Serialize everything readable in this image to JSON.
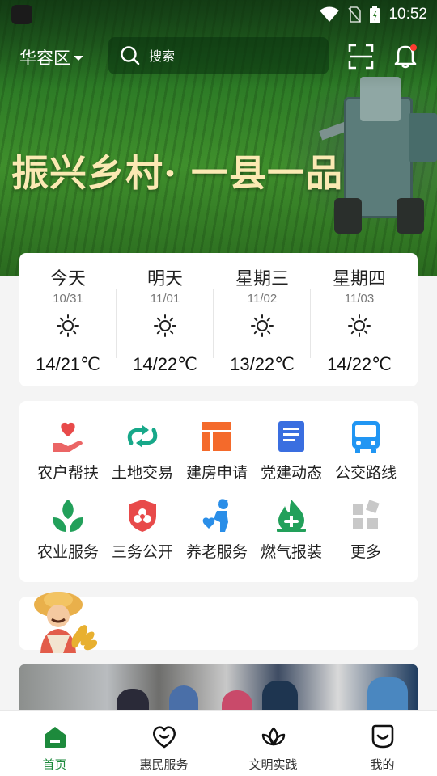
{
  "status_bar": {
    "time": "10:52"
  },
  "header": {
    "district": "华容区",
    "search_placeholder": "搜索"
  },
  "banner": {
    "title": "振兴乡村· 一县一品"
  },
  "weather": [
    {
      "day": "今天",
      "date": "10/31",
      "temp": "14/21℃"
    },
    {
      "day": "明天",
      "date": "11/01",
      "temp": "14/22℃"
    },
    {
      "day": "星期三",
      "date": "11/02",
      "temp": "13/22℃"
    },
    {
      "day": "星期四",
      "date": "11/03",
      "temp": "14/22℃"
    }
  ],
  "services": [
    {
      "label": "农户帮扶",
      "icon": "heart-hand-icon",
      "color": "#e84a4a"
    },
    {
      "label": "土地交易",
      "icon": "exchange-icon",
      "color": "#17a889"
    },
    {
      "label": "建房申请",
      "icon": "house-grid-icon",
      "color": "#f46a2b"
    },
    {
      "label": "党建动态",
      "icon": "document-icon",
      "color": "#3a6ee0"
    },
    {
      "label": "公交路线",
      "icon": "bus-icon",
      "color": "#2196f3"
    },
    {
      "label": "农业服务",
      "icon": "sprout-icon",
      "color": "#22a05a"
    },
    {
      "label": "三务公开",
      "icon": "shield-icon",
      "color": "#e84a4a"
    },
    {
      "label": "养老服务",
      "icon": "elderly-care-icon",
      "color": "#2a8ee8"
    },
    {
      "label": "燃气报装",
      "icon": "gas-flame-icon",
      "color": "#22a05a"
    },
    {
      "label": "更多",
      "icon": "more-grid-icon",
      "color": "#c8c8c8"
    }
  ],
  "tabs": [
    {
      "label": "首页",
      "icon": "home-icon",
      "active": true
    },
    {
      "label": "惠民服务",
      "icon": "heart-smile-icon",
      "active": false
    },
    {
      "label": "文明实践",
      "icon": "lotus-icon",
      "active": false
    },
    {
      "label": "我的",
      "icon": "profile-smile-icon",
      "active": false
    }
  ],
  "colors": {
    "primary": "#1d8a3c",
    "banner_text": "#fbe9b3"
  }
}
